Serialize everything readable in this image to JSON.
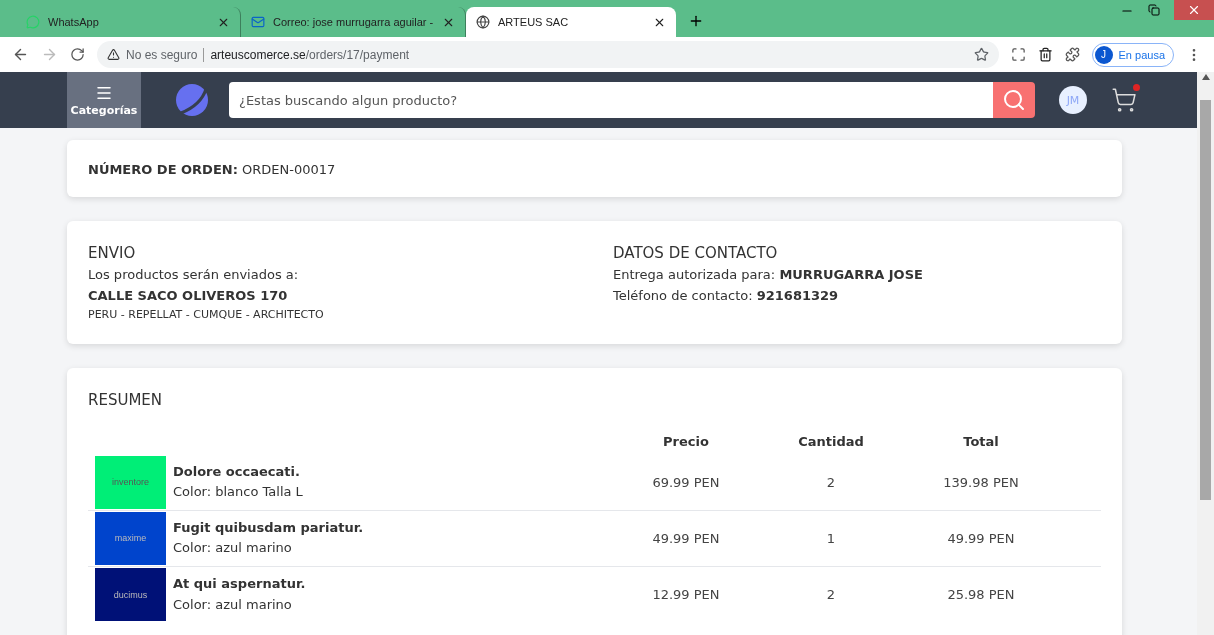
{
  "browser": {
    "tabs": [
      {
        "title": "WhatsApp",
        "selected": false
      },
      {
        "title": "Correo: jose murrugarra aguilar -",
        "selected": false
      },
      {
        "title": "ARTEUS SAC",
        "selected": true
      }
    ],
    "security": "No es seguro",
    "url_host": "arteuscomerce.se",
    "url_path": "/orders/17/payment",
    "profile_initial": "J",
    "profile_status": "En pausa"
  },
  "header": {
    "menu_label": "Categorías",
    "search_placeholder": "¿Estas buscando algun producto?",
    "avatar": "JM",
    "cart_has_notification": true
  },
  "order": {
    "label": "NÚMERO DE ORDEN:",
    "number": "ORDEN-00017"
  },
  "shipping": {
    "title": "ENVIO",
    "intro": "Los productos serán enviados a:",
    "address": "CALLE SACO OLIVEROS 170",
    "region": "PERU - REPELLAT - CUMQUE - ARCHITECTO"
  },
  "contact": {
    "title": "DATOS DE CONTACTO",
    "recipient_label": "Entrega autorizada para:",
    "recipient": "MURRUGARRA JOSE",
    "phone_label": "Teléfono de contacto:",
    "phone": "921681329"
  },
  "summary": {
    "title": "RESUMEN",
    "columns": [
      "Precio",
      "Cantidad",
      "Total"
    ],
    "rows": [
      {
        "thumb_text": "inventore",
        "color": "#00ee77",
        "name": "Dolore occaecati.",
        "detail": "Color: blanco Talla L",
        "price": "69.99 PEN",
        "qty": "2",
        "total": "139.98 PEN"
      },
      {
        "thumb_text": "maxime",
        "color": "#0044cc",
        "name": "Fugit quibusdam pariatur.",
        "detail": "Color: azul marino",
        "price": "49.99 PEN",
        "qty": "1",
        "total": "49.99 PEN"
      },
      {
        "thumb_text": "ducimus",
        "color": "#001177",
        "name": "At qui aspernatur.",
        "detail": "Color: azul marino",
        "price": "12.99 PEN",
        "qty": "2",
        "total": "25.98 PEN"
      }
    ]
  }
}
